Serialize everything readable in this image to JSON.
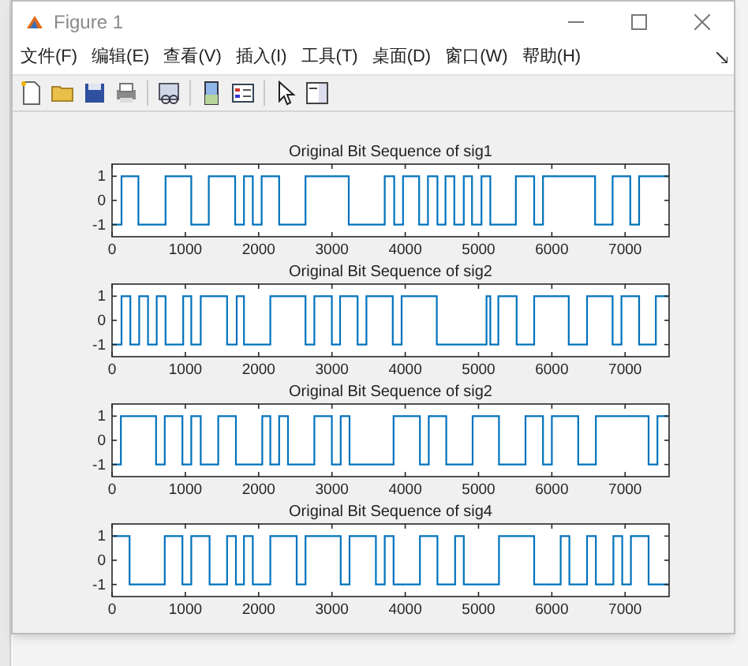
{
  "window": {
    "title": "Figure 1"
  },
  "menu": [
    {
      "label": "文件(F)"
    },
    {
      "label": "编辑(E)"
    },
    {
      "label": "查看(V)"
    },
    {
      "label": "插入(I)"
    },
    {
      "label": "工具(T)"
    },
    {
      "label": "桌面(D)"
    },
    {
      "label": "窗口(W)"
    },
    {
      "label": "帮助(H)"
    }
  ],
  "subplots": [
    {
      "chart_data": {
        "type": "line",
        "title": "Original Bit Sequence of sig1",
        "xlim": [
          0,
          7600
        ],
        "ylim": [
          -1.5,
          1.5
        ],
        "xticks": [
          0,
          1000,
          2000,
          3000,
          4000,
          5000,
          6000,
          7000
        ],
        "yticks": [
          -1,
          0,
          1
        ],
        "x": [
          0,
          130,
          130,
          360,
          360,
          730,
          730,
          1080,
          1080,
          1320,
          1320,
          1680,
          1680,
          1800,
          1800,
          1920,
          1920,
          2040,
          2040,
          2280,
          2280,
          2640,
          2640,
          3230,
          3230,
          3720,
          3720,
          3850,
          3850,
          3970,
          3970,
          4190,
          4190,
          4310,
          4310,
          4440,
          4440,
          4550,
          4550,
          4670,
          4670,
          4800,
          4800,
          4910,
          4910,
          5040,
          5040,
          5160,
          5160,
          5510,
          5510,
          5760,
          5760,
          5880,
          5880,
          6590,
          6590,
          6830,
          6830,
          7070,
          7070,
          7190,
          7190,
          7600
        ],
        "series": [
          {
            "color": "#0072bd",
            "values": [
              -1,
              -1,
              1,
              1,
              -1,
              -1,
              1,
              1,
              -1,
              -1,
              1,
              1,
              -1,
              -1,
              1,
              1,
              -1,
              -1,
              1,
              1,
              -1,
              -1,
              1,
              1,
              -1,
              -1,
              1,
              1,
              -1,
              -1,
              1,
              1,
              -1,
              -1,
              1,
              1,
              -1,
              -1,
              1,
              1,
              -1,
              -1,
              1,
              1,
              -1,
              -1,
              1,
              1,
              -1,
              -1,
              1,
              1,
              -1,
              -1,
              1,
              1,
              -1,
              -1,
              1,
              1,
              -1,
              -1,
              1,
              1
            ]
          }
        ]
      }
    },
    {
      "chart_data": {
        "type": "line",
        "title": "Original Bit Sequence of sig2",
        "xlim": [
          0,
          7600
        ],
        "ylim": [
          -1.5,
          1.5
        ],
        "xticks": [
          0,
          1000,
          2000,
          3000,
          4000,
          5000,
          6000,
          7000
        ],
        "yticks": [
          -1,
          0,
          1
        ],
        "x": [
          0,
          130,
          130,
          250,
          250,
          370,
          370,
          490,
          490,
          610,
          610,
          730,
          730,
          970,
          970,
          1080,
          1080,
          1210,
          1210,
          1570,
          1570,
          1700,
          1700,
          1800,
          1800,
          2160,
          2160,
          2640,
          2640,
          2760,
          2760,
          3000,
          3000,
          3110,
          3110,
          3350,
          3350,
          3470,
          3470,
          3830,
          3830,
          3950,
          3950,
          4430,
          4430,
          5110,
          5110,
          5160,
          5160,
          5270,
          5270,
          5520,
          5520,
          5760,
          5760,
          6230,
          6230,
          6480,
          6480,
          6830,
          6830,
          6950,
          6950,
          7190,
          7190,
          7420,
          7420,
          7600
        ],
        "series": [
          {
            "color": "#0072bd",
            "values": [
              -1,
              -1,
              1,
              1,
              -1,
              -1,
              1,
              1,
              -1,
              -1,
              1,
              1,
              -1,
              -1,
              1,
              1,
              -1,
              -1,
              1,
              1,
              -1,
              -1,
              1,
              1,
              -1,
              -1,
              1,
              1,
              -1,
              -1,
              1,
              1,
              -1,
              -1,
              1,
              1,
              -1,
              -1,
              1,
              1,
              -1,
              -1,
              1,
              1,
              -1,
              -1,
              1,
              1,
              -1,
              -1,
              1,
              1,
              -1,
              -1,
              1,
              1,
              -1,
              -1,
              1,
              1,
              -1,
              -1,
              1,
              1,
              -1,
              -1,
              1,
              1
            ]
          }
        ]
      }
    },
    {
      "chart_data": {
        "type": "line",
        "title": "Original Bit Sequence of sig2",
        "xlim": [
          0,
          7600
        ],
        "ylim": [
          -1.5,
          1.5
        ],
        "xticks": [
          0,
          1000,
          2000,
          3000,
          4000,
          5000,
          6000,
          7000
        ],
        "yticks": [
          -1,
          0,
          1
        ],
        "x": [
          0,
          120,
          120,
          600,
          600,
          720,
          720,
          960,
          960,
          1080,
          1080,
          1210,
          1210,
          1450,
          1450,
          1690,
          1690,
          2050,
          2050,
          2160,
          2160,
          2280,
          2280,
          2400,
          2400,
          2760,
          2760,
          3000,
          3000,
          3120,
          3120,
          3240,
          3240,
          3840,
          3840,
          4200,
          4200,
          4320,
          4320,
          4560,
          4560,
          4920,
          4920,
          5280,
          5280,
          5640,
          5640,
          5880,
          5880,
          6000,
          6000,
          6360,
          6360,
          6600,
          6600,
          7320,
          7320,
          7440,
          7440,
          7600
        ],
        "series": [
          {
            "color": "#0072bd",
            "values": [
              -1,
              -1,
              1,
              1,
              -1,
              -1,
              1,
              1,
              -1,
              -1,
              1,
              1,
              -1,
              -1,
              1,
              1,
              -1,
              -1,
              1,
              1,
              -1,
              -1,
              1,
              1,
              -1,
              -1,
              1,
              1,
              -1,
              -1,
              1,
              1,
              -1,
              -1,
              1,
              1,
              -1,
              -1,
              1,
              1,
              -1,
              -1,
              1,
              1,
              -1,
              -1,
              1,
              1,
              -1,
              -1,
              1,
              1,
              -1,
              -1,
              1,
              1,
              -1,
              -1,
              1,
              1
            ]
          }
        ]
      }
    },
    {
      "chart_data": {
        "type": "line",
        "title": "Original Bit Sequence of sig4",
        "xlim": [
          0,
          7600
        ],
        "ylim": [
          -1.5,
          1.5
        ],
        "xticks": [
          0,
          1000,
          2000,
          3000,
          4000,
          5000,
          6000,
          7000
        ],
        "yticks": [
          -1,
          0,
          1
        ],
        "x": [
          0,
          240,
          240,
          720,
          720,
          960,
          960,
          1080,
          1080,
          1330,
          1330,
          1570,
          1570,
          1690,
          1690,
          1800,
          1800,
          1920,
          1920,
          2160,
          2160,
          2520,
          2520,
          2640,
          2640,
          3120,
          3120,
          3240,
          3240,
          3600,
          3600,
          3720,
          3720,
          3840,
          3840,
          4200,
          4200,
          4440,
          4440,
          4680,
          4680,
          4800,
          4800,
          5280,
          5280,
          5760,
          5760,
          6120,
          6120,
          6240,
          6240,
          6480,
          6480,
          6600,
          6600,
          6840,
          6840,
          6960,
          6960,
          7080,
          7080,
          7320,
          7320,
          7600
        ],
        "series": [
          {
            "color": "#0072bd",
            "values": [
              1,
              1,
              -1,
              -1,
              1,
              1,
              -1,
              -1,
              1,
              1,
              -1,
              -1,
              1,
              1,
              -1,
              -1,
              1,
              1,
              -1,
              -1,
              1,
              1,
              -1,
              -1,
              1,
              1,
              -1,
              -1,
              1,
              1,
              -1,
              -1,
              1,
              1,
              -1,
              -1,
              1,
              1,
              -1,
              -1,
              1,
              1,
              -1,
              -1,
              1,
              1,
              -1,
              -1,
              1,
              1,
              -1,
              -1,
              1,
              1,
              -1,
              -1,
              1,
              1,
              -1,
              -1,
              1,
              1,
              -1,
              -1
            ]
          }
        ]
      }
    }
  ]
}
